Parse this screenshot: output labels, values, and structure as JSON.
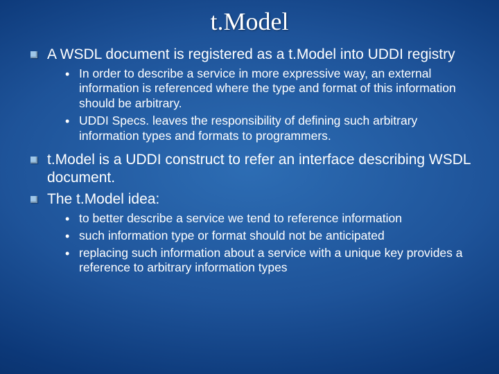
{
  "title": "t.Model",
  "bullets": [
    {
      "text": "A WSDL document is registered as a t.Model into UDDI registry",
      "sub": [
        "In order to describe a service in more expressive way, an external information is referenced where the type and format of this information should be arbitrary.",
        "UDDI Specs. leaves the responsibility of defining such arbitrary information types and formats to programmers."
      ]
    },
    {
      "text": "t.Model is a UDDI construct to refer an interface describing WSDL document.",
      "sub": []
    },
    {
      "text": "The t.Model idea:",
      "sub": [
        "to better describe a service we tend to reference information",
        "such information type or format should not be anticipated",
        "replacing such information about a service with a unique key provides a  reference to arbitrary information types"
      ]
    }
  ]
}
